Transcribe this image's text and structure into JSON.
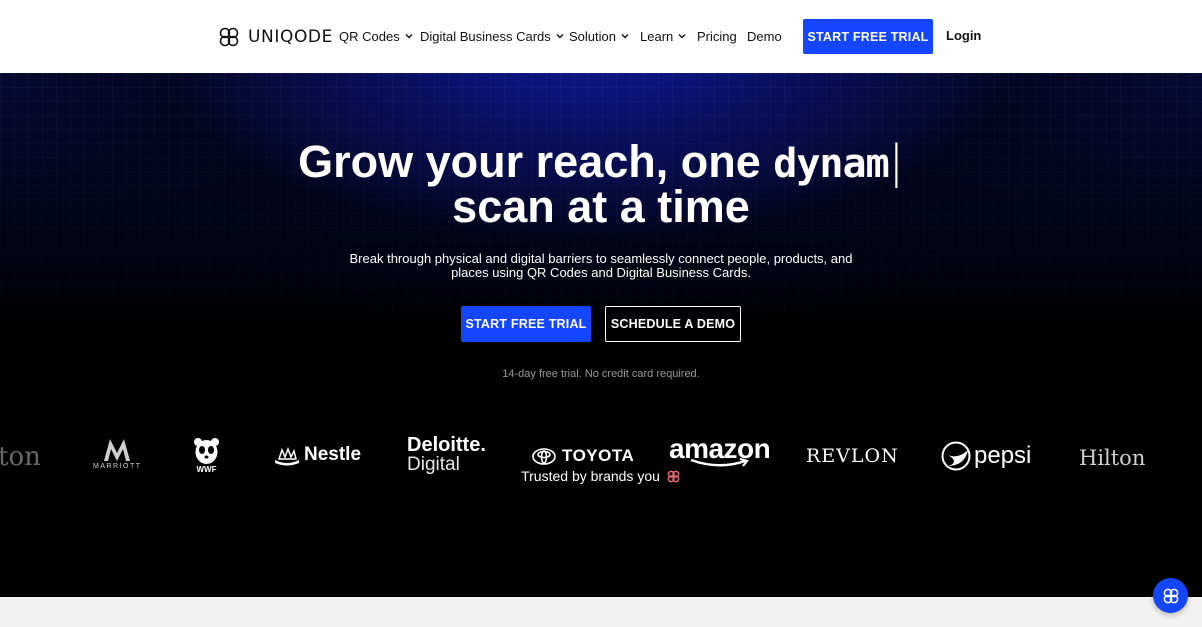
{
  "nav": {
    "logo_text": "UNIQODE",
    "items": [
      {
        "label": "QR Codes",
        "dropdown": true
      },
      {
        "label": "Digital Business Cards",
        "dropdown": true
      },
      {
        "label": "Solution",
        "dropdown": true
      },
      {
        "label": "Learn",
        "dropdown": true
      },
      {
        "label": "Pricing",
        "dropdown": false
      },
      {
        "label": "Demo",
        "dropdown": false
      }
    ],
    "cta_label": "START FREE TRIAL",
    "login_label": "Login"
  },
  "hero": {
    "headline_line1": "Grow your reach, one ",
    "typed_word": "dynam",
    "caret": "|",
    "headline_line2": "scan at a time",
    "subtext": "Break through physical and digital barriers to seamlessly connect people, products, and places using QR Codes and Digital Business Cards.",
    "primary_cta": "START FREE TRIAL",
    "secondary_cta": "SCHEDULE A DEMO",
    "trial_note": "14-day free trial. No credit card required.",
    "trusted_label": "Trusted by brands you",
    "trusted_icon": "heart-logo-icon"
  },
  "brands": {
    "hilton_left": "ton",
    "marriott": "MARRIOTT",
    "wwf": "WWF",
    "nestle": "Nestle",
    "deloitte_1": "Deloitte.",
    "deloitte_2": "Digital",
    "toyota": "TOYOTA",
    "amazon": "amazon",
    "revlon": "REVLON",
    "pepsi": "pepsi",
    "hilton_right": "Hilton"
  },
  "colors": {
    "accent": "#1446ff",
    "hero_bg": "#000000",
    "hero_glow": "#0b1a8a"
  }
}
